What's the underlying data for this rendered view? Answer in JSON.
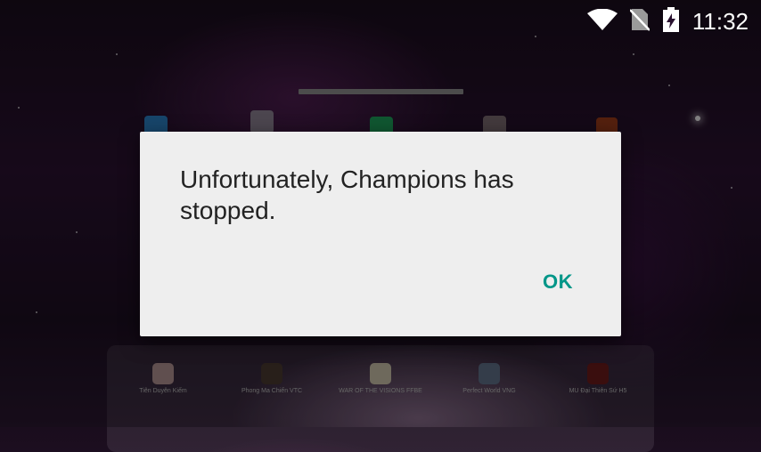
{
  "status_bar": {
    "time": "11:32",
    "icons": [
      "wifi-icon",
      "no-sim-icon",
      "battery-charging-icon"
    ]
  },
  "home_apps": [
    {
      "icon": "app-icon-1",
      "color": "#2a7fc1"
    },
    {
      "icon": "app-icon-2",
      "color": "#8a8090"
    },
    {
      "icon": "app-icon-3",
      "color": "#1e9e5a"
    },
    {
      "icon": "app-icon-4",
      "color": "#7a6a70"
    },
    {
      "icon": "app-icon-5",
      "color": "#9a3b1a"
    }
  ],
  "dock": {
    "apps": [
      {
        "label": "Tiên Duyên Kiếm",
        "color": "#b09090"
      },
      {
        "label": "Phong Ma Chiến VTC",
        "color": "#4a3a30"
      },
      {
        "label": "WAR OF THE VISIONS FFBE",
        "color": "#c8c0a8"
      },
      {
        "label": "Perfect World VNG",
        "color": "#607088"
      },
      {
        "label": "MU Đại Thiên Sứ H5",
        "color": "#6a1a1a"
      }
    ]
  },
  "dialog": {
    "message": "Unfortunately, Champions has stopped.",
    "ok_label": "OK",
    "accent_color": "#009688"
  }
}
